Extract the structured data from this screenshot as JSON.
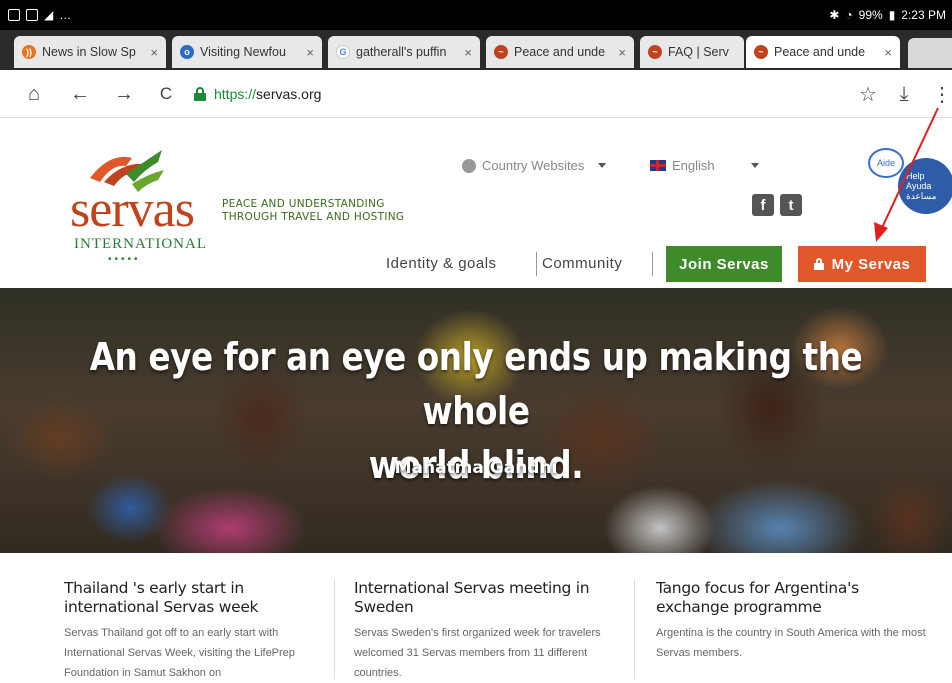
{
  "status_bar": {
    "battery": "99%",
    "time": "2:23 PM"
  },
  "tabs": [
    {
      "label": "News in Slow Sp",
      "favicon": "rss-icon",
      "color": "#e8741e",
      "active": false
    },
    {
      "label": "Visiting Newfou",
      "favicon": "circle-icon",
      "color": "#2a6ac8",
      "active": false
    },
    {
      "label": "gatherall's puffin",
      "favicon": "google-icon",
      "color": "#4285f4",
      "active": false
    },
    {
      "label": "Peace and unde",
      "favicon": "servas-icon",
      "color": "#c0431e",
      "active": false
    },
    {
      "label": "FAQ | Serv",
      "favicon": "servas-icon",
      "color": "#c0431e",
      "active": false
    },
    {
      "label": "Peace and unde",
      "favicon": "servas-icon",
      "color": "#c0431e",
      "active": true
    }
  ],
  "tab_close": "×",
  "toolbar": {
    "url_protocol": "https://",
    "url_host": "servas.org",
    "home": "⌂",
    "back": "←",
    "forward": "→",
    "reload": "C",
    "star": "☆",
    "download": "⤓",
    "menu": "⋮"
  },
  "site": {
    "logo_word": "servas",
    "logo_sub": "INTERNATIONAL",
    "logo_dots": "•••••",
    "tagline_1": "PEACE AND UNDERSTANDING",
    "tagline_2": "THROUGH TRAVEL AND HOSTING",
    "country_websites": "Country Websites",
    "language": "English",
    "help_bubble": "Aide",
    "help_badge_1": "Help",
    "help_badge_2": "Ayuda",
    "help_badge_3": "مساعدة",
    "facebook": "f",
    "twitter": "t"
  },
  "nav": {
    "identity": "Identity & goals",
    "community": "Community",
    "join": "Join Servas",
    "my": "My Servas"
  },
  "hero": {
    "quote_line1": "An eye for an eye only ends up making the whole",
    "quote_line2": "world blind.",
    "author": "Mahatma Gandhi"
  },
  "news": [
    {
      "title": "Thailand 's early start in international Servas week",
      "body": "Servas Thailand got off to an early start with International Servas Week, visiting the LifePrep Foundation in Samut Sakhon on"
    },
    {
      "title": "International Servas meeting in Sweden",
      "body": "Servas Sweden's first organized week for travelers welcomed 31 Servas members from 11 different countries."
    },
    {
      "title": "Tango focus for Argentina's exchange programme",
      "body": "Argentina is the country in South America with the most Servas members."
    }
  ],
  "colors": {
    "brand_orange": "#e0572a",
    "brand_green": "#3f8b2b",
    "annotation_arrow": "#e02020"
  }
}
